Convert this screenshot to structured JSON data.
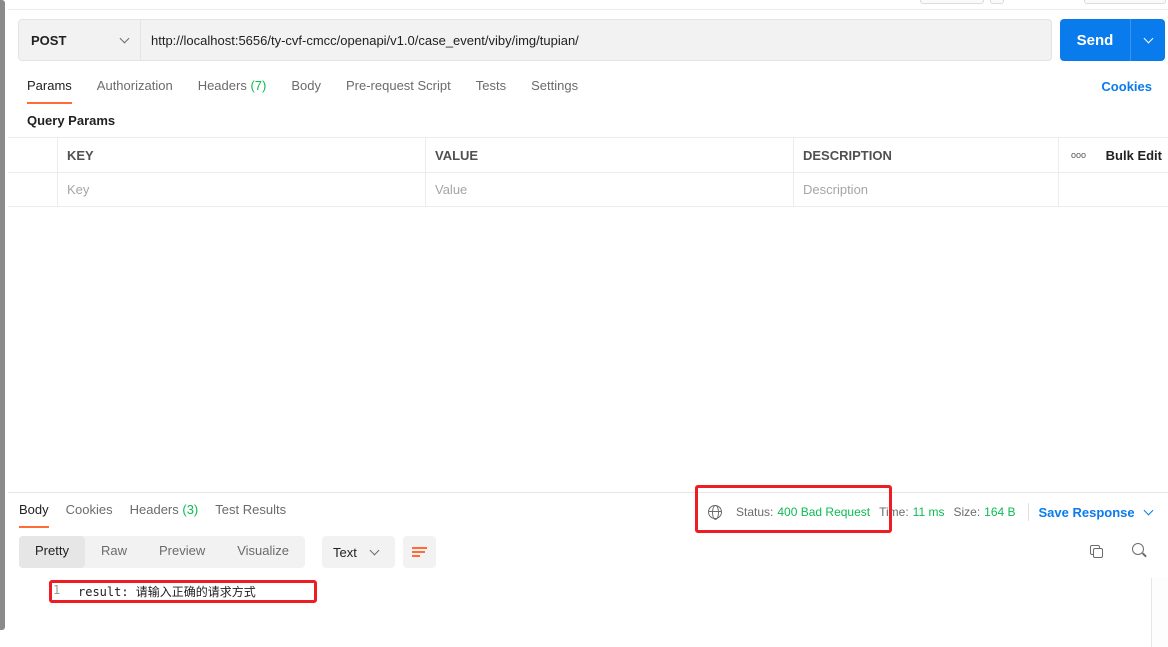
{
  "request": {
    "method": "POST",
    "url": "http://localhost:5656/ty-cvf-cmcc/openapi/v1.0/case_event/viby/img/tupian/",
    "send_label": "Send"
  },
  "request_tabs": {
    "params": "Params",
    "authorization": "Authorization",
    "headers": "Headers",
    "headers_count": "(7)",
    "body": "Body",
    "pre_request": "Pre-request Script",
    "tests": "Tests",
    "settings": "Settings",
    "cookies": "Cookies"
  },
  "query_params": {
    "title": "Query Params",
    "columns": [
      "KEY",
      "VALUE",
      "DESCRIPTION"
    ],
    "more": "ooo",
    "bulk_edit": "Bulk Edit",
    "placeholders": [
      "Key",
      "Value",
      "Description"
    ]
  },
  "response": {
    "tabs": {
      "body": "Body",
      "cookies": "Cookies",
      "headers": "Headers",
      "headers_count": "(3)",
      "test_results": "Test Results"
    },
    "status_label": "Status:",
    "status_value": "400 Bad Request",
    "time_label": "Time:",
    "time_value": "11 ms",
    "size_label": "Size:",
    "size_value": "164 B",
    "save_response": "Save Response",
    "view_tabs": [
      "Pretty",
      "Raw",
      "Preview",
      "Visualize"
    ],
    "format": "Text",
    "line_number": "1",
    "body_line": "result: 请输入正确的请求方式"
  },
  "colors": {
    "accent": "#ff6c37",
    "primary": "#097bed",
    "success": "#0cbb52",
    "highlight": "#ee1d23"
  }
}
